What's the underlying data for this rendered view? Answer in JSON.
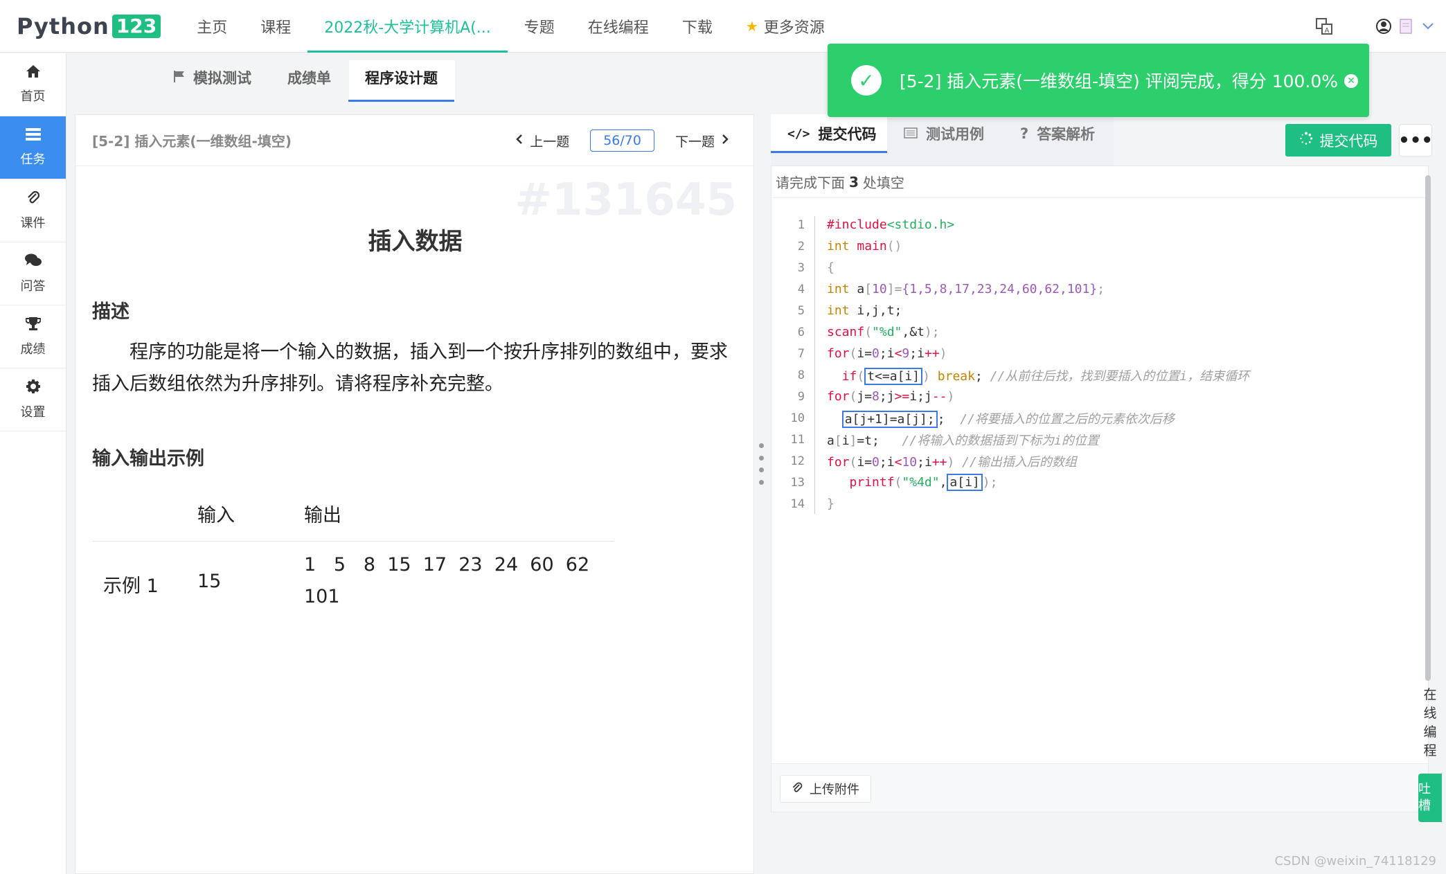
{
  "brand": {
    "name": "Python",
    "badge": "123"
  },
  "nav": {
    "items": [
      "主页",
      "课程",
      "2022秋-大学计算机A(...",
      "专题",
      "在线编程",
      "下载",
      "更多资源"
    ],
    "active_index": 2
  },
  "sidebar": {
    "items": [
      {
        "icon": "home-icon",
        "label": "首页"
      },
      {
        "icon": "tasks-icon",
        "label": "任务"
      },
      {
        "icon": "paperclip-icon",
        "label": "课件"
      },
      {
        "icon": "chat-icon",
        "label": "问答"
      },
      {
        "icon": "trophy-icon",
        "label": "成绩"
      },
      {
        "icon": "gear-icon",
        "label": "设置"
      }
    ],
    "active_index": 1
  },
  "subtabs": [
    "模拟测试",
    "成绩单",
    "程序设计题"
  ],
  "problem": {
    "header_title": "[5-2] 插入元素(一维数组-填空)",
    "prev": "上一题",
    "next": "下一题",
    "page": "56/70",
    "id_watermark": "#131645",
    "title": "插入数据",
    "desc_heading": "描述",
    "description": "程序的功能是将一个输入的数据，插入到一个按升序排列的数组中，要求插入后数组依然为升序排列。请将程序补充完整。",
    "io_heading": "输入输出示例",
    "io_headers": {
      "input": "输入",
      "output": "输出"
    },
    "io_rows": [
      {
        "label": "示例 1",
        "input": "15",
        "output_line1": "1   5   8  15  17  23  24  60  62",
        "output_line2": "101"
      }
    ]
  },
  "editor": {
    "tabs": [
      "提交代码",
      "测试用例",
      "答案解析"
    ],
    "submit_label": "提交代码",
    "more_label": "•••",
    "hint_prefix": "请完成下面",
    "hint_count": "3",
    "hint_suffix": "处填空",
    "upload_label": "上传附件",
    "line_numbers": [
      "1",
      "2",
      "3",
      "4",
      "5",
      "6",
      "7",
      "8",
      "9",
      "10",
      "11",
      "12",
      "13",
      "14"
    ],
    "blanks": [
      "t<=a[i]",
      "a[j+1]=a[j];",
      "a[i]"
    ]
  },
  "toast": {
    "message": "[5-2] 插入元素(一维数组-填空) 评阅完成，得分 100.0%"
  },
  "side_float": {
    "online_edit": "在线编程",
    "tucao": "吐槽"
  },
  "watermark_csdn": "CSDN @weixin_74118129"
}
